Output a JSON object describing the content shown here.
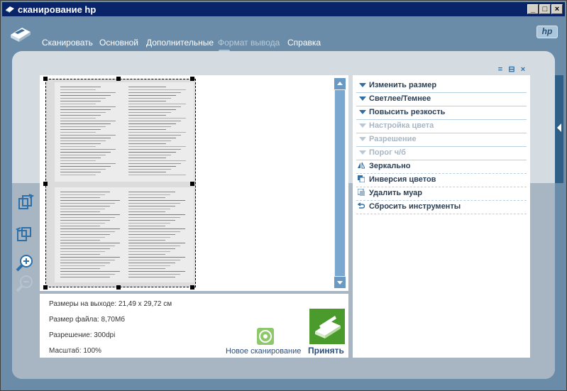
{
  "window": {
    "title": "сканирование hp",
    "min_label": "_",
    "max_label": "□",
    "close_label": "×"
  },
  "menu": {
    "items": [
      "Сканировать",
      "Основной",
      "Дополнительные",
      "Формат вывода",
      "Справка"
    ],
    "active_index": 3
  },
  "brand": {
    "hp": "hp"
  },
  "panel": {
    "ctrl1": "=",
    "ctrl2": "⊟",
    "ctrl3": "×"
  },
  "tools": [
    {
      "label": "Изменить размер",
      "enabled": true,
      "icon": "triangle-down-icon"
    },
    {
      "label": "Светлее/Темнее",
      "enabled": true,
      "icon": "triangle-down-icon"
    },
    {
      "label": "Повысить резкость",
      "enabled": true,
      "icon": "triangle-down-icon"
    },
    {
      "label": "Настройка цвета",
      "enabled": false,
      "icon": "triangle-down-icon"
    },
    {
      "label": "Разрешение",
      "enabled": false,
      "icon": "triangle-down-icon"
    },
    {
      "label": "Порог ч/б",
      "enabled": false,
      "icon": "triangle-down-icon"
    },
    {
      "label": "Зеркально",
      "enabled": true,
      "icon": "mirror-icon"
    },
    {
      "label": "Инверсия цветов",
      "enabled": true,
      "icon": "invert-colors-icon"
    },
    {
      "label": "Удалить муар",
      "enabled": true,
      "icon": "descreen-icon"
    },
    {
      "label": "Сбросить инструменты",
      "enabled": true,
      "icon": "reset-icon"
    }
  ],
  "info": {
    "output_size": "Размеры на выходе: 21,49 x 29,72 см",
    "file_size": "Размер файла: 8,70Мб",
    "resolution": "Разрешение:  300dpi",
    "scale": "Масштаб: 100%"
  },
  "actions": {
    "new_scan": "Новое сканирование",
    "accept": "Принять"
  },
  "colors": {
    "background": "#6a8ca8",
    "accent": "#2f6fa8",
    "accept_green": "#4a9b2c"
  }
}
